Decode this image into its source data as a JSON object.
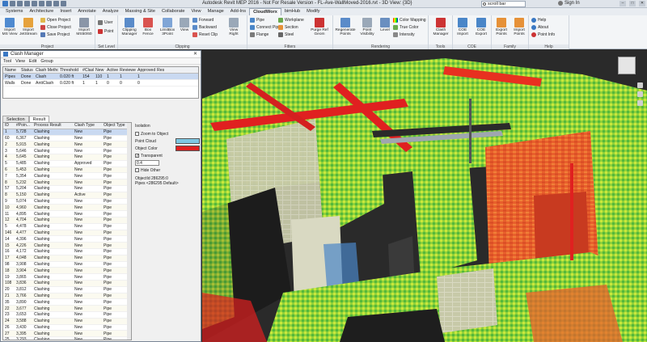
{
  "app": {
    "title": "Autodesk Revit MEP 2016 - Not For Resale Version -  FL-Ave-WallMoved-2016.rvt - 3D View: {3D}",
    "search_placeholder": "scroll bar",
    "sign_in": "Sign In"
  },
  "menu_tabs": [
    "Systems",
    "Architecture",
    "Insert",
    "Annotate",
    "Analyze",
    "Massing & Site",
    "Collaborate",
    "View",
    "Manage",
    "Add-Ins",
    "CloudWorx",
    "bimHub",
    "Modify"
  ],
  "active_tab": "CloudWorx",
  "ribbon": {
    "project_panel": {
      "label": "Project",
      "import_label": "Import MS View",
      "import_jet_label": "Import JetStream",
      "open_project": "Open Project",
      "close_project": "Close Project",
      "save_project": "Save Project"
    },
    "import_label": "Import MS50/60",
    "setlevel_panel": {
      "label": "Set Level By",
      "user": "User",
      "point": "Point"
    },
    "clipping_panel": {
      "label": "Clipping",
      "clip_mgr": "Clipping Manager",
      "box_fence": "Box Fence",
      "limitbox": "LimitBox 3Point",
      "view": "View",
      "forward": "Forward",
      "backward": "Backward",
      "reset_clip": "Reset Clip",
      "view_right": "View Right"
    },
    "fitters_panel": {
      "label": "Fitters",
      "pipe": "Pipe",
      "connect_pipe": "Connect Pipe",
      "flange": "Flange",
      "workplane": "Workplane",
      "section": "Section",
      "steel": "Steel",
      "purge": "Purge Ref Geom"
    },
    "rendering_panel": {
      "label": "Rendering",
      "regen": "Regenerate Points",
      "vis": "Point Visibility",
      "level": "Level",
      "color_map": "Color Mapping",
      "true_color": "True Color",
      "intensity": "Intensity"
    },
    "tools_panel": {
      "label": "Tools",
      "clash": "Clash Manager"
    },
    "coe_panel": {
      "label": "COE",
      "import": "COE Import",
      "export": "COE Export"
    },
    "family_panel": {
      "label": "Family",
      "export": "Export Points",
      "import": "Import Points"
    },
    "help_panel": {
      "label": "Help",
      "help": "Help",
      "about": "About",
      "point_info": "Point Info"
    }
  },
  "clash_manager": {
    "title": "Clash Manager",
    "menu": [
      "Tool",
      "View",
      "Edit",
      "Group"
    ],
    "tests_headers": [
      "Name",
      "Status",
      "Clash Method",
      "Threshold",
      "#Clash",
      "New",
      "Active",
      "Reviewed",
      "Approved",
      "Res"
    ],
    "tests": [
      [
        "Pipes",
        "Done",
        "Clash",
        "0.020 ft",
        "154",
        "110",
        "1",
        "1",
        "1",
        ""
      ],
      [
        "Walls",
        "Done",
        "AntiClash",
        "0.020 ft",
        "1",
        "1",
        "0",
        "0",
        "0",
        ""
      ]
    ],
    "tabs": [
      "Selection",
      "Result"
    ],
    "active_tab": "Result",
    "result_headers": [
      "ID",
      "#Poin...",
      "Process Result",
      "Clash Type",
      "Object Type"
    ],
    "results": [
      [
        "1",
        "5,728",
        "Clashing",
        "New",
        "Pipe"
      ],
      [
        "60",
        "6,367",
        "Clashing",
        "New",
        "Pipe"
      ],
      [
        "2",
        "5,915",
        "Clashing",
        "New",
        "Pipe"
      ],
      [
        "3",
        "5,646",
        "Clashing",
        "New",
        "Pipe"
      ],
      [
        "4",
        "5,645",
        "Clashing",
        "New",
        "Pipe"
      ],
      [
        "5",
        "5,485",
        "Clashing",
        "Approved",
        "Pipe"
      ],
      [
        "6",
        "5,453",
        "Clashing",
        "New",
        "Pipe"
      ],
      [
        "7",
        "5,354",
        "Clashing",
        "New",
        "Pipe"
      ],
      [
        "8",
        "5,232",
        "Clashing",
        "New",
        "Pipe"
      ],
      [
        "57",
        "5,204",
        "Clashing",
        "New",
        "Pipe"
      ],
      [
        "8",
        "5,150",
        "Clashing",
        "Active",
        "Pipe"
      ],
      [
        "9",
        "5,074",
        "Clashing",
        "New",
        "Pipe"
      ],
      [
        "10",
        "4,960",
        "Clashing",
        "New",
        "Pipe"
      ],
      [
        "11",
        "4,895",
        "Clashing",
        "New",
        "Pipe"
      ],
      [
        "12",
        "4,704",
        "Clashing",
        "New",
        "Pipe"
      ],
      [
        "5",
        "4,478",
        "Clashing",
        "New",
        "Pipe"
      ],
      [
        "146",
        "4,477",
        "Clashing",
        "New",
        "Pipe"
      ],
      [
        "14",
        "4,396",
        "Clashing",
        "New",
        "Pipe"
      ],
      [
        "15",
        "4,226",
        "Clashing",
        "New",
        "Pipe"
      ],
      [
        "16",
        "4,172",
        "Clashing",
        "New",
        "Pipe"
      ],
      [
        "17",
        "4,048",
        "Clashing",
        "New",
        "Pipe"
      ],
      [
        "98",
        "3,908",
        "Clashing",
        "New",
        "Pipe"
      ],
      [
        "18",
        "3,904",
        "Clashing",
        "New",
        "Pipe"
      ],
      [
        "19",
        "3,865",
        "Clashing",
        "New",
        "Pipe"
      ],
      [
        "108",
        "3,836",
        "Clashing",
        "New",
        "Pipe"
      ],
      [
        "20",
        "3,812",
        "Clashing",
        "New",
        "Pipe"
      ],
      [
        "21",
        "3,766",
        "Clashing",
        "New",
        "Pipe"
      ],
      [
        "35",
        "3,890",
        "Clashing",
        "New",
        "Pipe"
      ],
      [
        "22",
        "3,677",
        "Clashing",
        "New",
        "Pipe"
      ],
      [
        "23",
        "3,653",
        "Clashing",
        "New",
        "Pipe"
      ],
      [
        "24",
        "3,588",
        "Clashing",
        "New",
        "Pipe"
      ],
      [
        "26",
        "3,430",
        "Clashing",
        "New",
        "Pipe"
      ],
      [
        "27",
        "3,395",
        "Clashing",
        "New",
        "Pipe"
      ],
      [
        "25",
        "3,293",
        "Clashing",
        "New",
        "Pipe"
      ]
    ],
    "isolation": {
      "title": "Isolation",
      "zoom_label": "Zoom to Object",
      "point_cloud_label": "Point Cloud",
      "object_color_label": "Object Color",
      "transparent_label": "Transparent",
      "transparency_value": "0.4",
      "hide_other_label": "Hide Other",
      "object_id_label": "ObjectId 286295:0",
      "pipe_label": "Pipes <286295 Default>"
    },
    "colors": {
      "point_cloud": "#7ec8e3",
      "object": "#e02020"
    }
  }
}
